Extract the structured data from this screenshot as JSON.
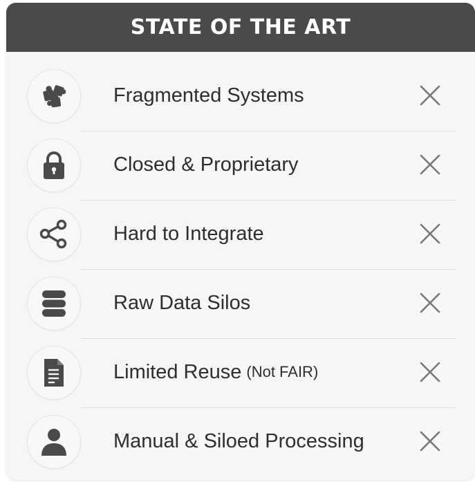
{
  "header": {
    "title": "STATE OF THE ART"
  },
  "items": [
    {
      "icon": "puzzle-icon",
      "label": "Fragmented Systems",
      "note": ""
    },
    {
      "icon": "lock-icon",
      "label": "Closed & Proprietary",
      "note": ""
    },
    {
      "icon": "share-icon",
      "label": "Hard to Integrate",
      "note": ""
    },
    {
      "icon": "database-icon",
      "label": "Raw Data Silos",
      "note": ""
    },
    {
      "icon": "document-icon",
      "label": "Limited Reuse",
      "note": "(Not FAIR)"
    },
    {
      "icon": "user-icon",
      "label": "Manual & Siloed Processing",
      "note": ""
    }
  ],
  "colors": {
    "header_bg": "#4a4a4a",
    "card_bg": "#f6f6f6",
    "icon": "#4a4a4a",
    "text": "#2e2e2e",
    "close": "#777777"
  }
}
